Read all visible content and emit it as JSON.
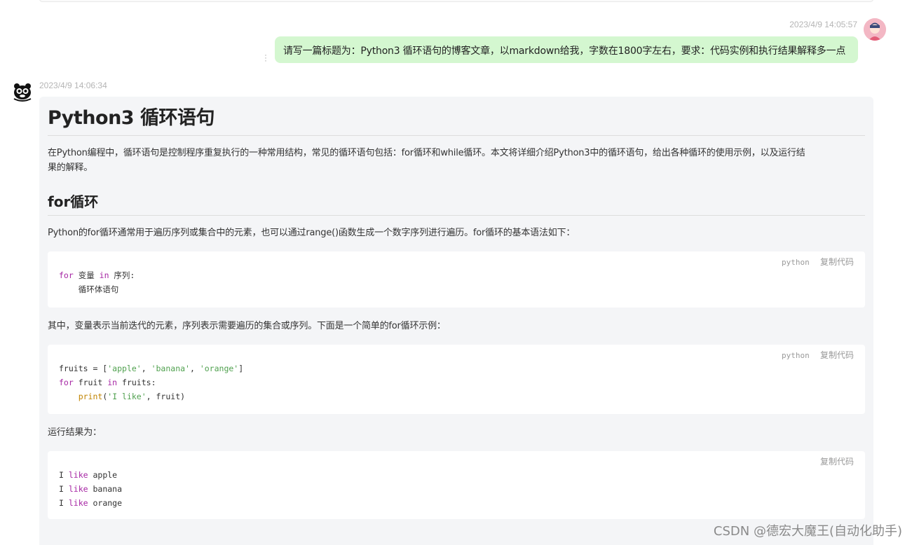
{
  "user_message": {
    "timestamp": "2023/4/9 14:05:57",
    "text": "请写一篇标题为：Python3 循环语句的博客文章，以markdown给我，字数在1800字左右，要求：代码实例和执行结果解释多一点"
  },
  "bot_message": {
    "timestamp": "2023/4/9 14:06:34",
    "title": "Python3 循环语句",
    "intro_line1": "在Python编程中，循环语句是控制程序重复执行的一种常用结构，常见的循环语句包括：for循环和while循环。本文将详细介绍Python3中的循环语句，给出各种循环的使用示例，以及运行结",
    "intro_line2": "果的解释。",
    "section_for": "for循环",
    "for_desc": "Python的for循环通常用于遍历序列或集合中的元素，也可以通过range()函数生成一个数字序列进行遍历。for循环的基本语法如下：",
    "code1": {
      "lang": "python",
      "copy": "复制代码",
      "l1_kw": "for",
      "l1_a": " 变量 ",
      "l1_kw2": "in",
      "l1_b": " 序列:",
      "l2": "    循环体语句"
    },
    "example_desc": "其中，变量表示当前迭代的元素，序列表示需要遍历的集合或序列。下面是一个简单的for循环示例：",
    "code2": {
      "lang": "python",
      "copy": "复制代码",
      "l1_a": "fruits = [",
      "l1_s1": "'apple'",
      "l1_c1": ", ",
      "l1_s2": "'banana'",
      "l1_c2": ", ",
      "l1_s3": "'orange'",
      "l1_b": "]",
      "l2_kw": "for",
      "l2_a": " fruit ",
      "l2_kw2": "in",
      "l2_b": " fruits:",
      "l3_ind": "    ",
      "l3_fn": "print",
      "l3_a": "(",
      "l3_s": "'I like'",
      "l3_b": ", fruit)"
    },
    "result_label": "运行结果为：",
    "code3": {
      "copy": "复制代码",
      "lines": [
        {
          "a": "I ",
          "kw": "like",
          "b": " apple"
        },
        {
          "a": "I ",
          "kw": "like",
          "b": " banana"
        },
        {
          "a": "I ",
          "kw": "like",
          "b": " orange"
        }
      ]
    }
  },
  "watermark": "CSDN @德宏大魔王(自动化助手)",
  "colors": {
    "user_bubble": "#d4f7d0",
    "bot_card": "#f4f5f7",
    "keyword": "#a626a4",
    "string": "#50a14f",
    "function": "#c18401"
  }
}
